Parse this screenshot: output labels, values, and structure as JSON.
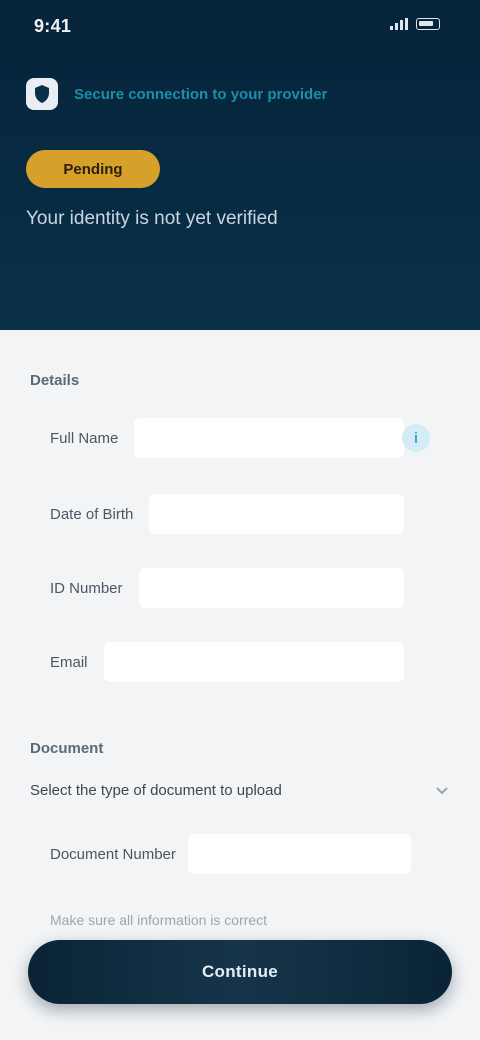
{
  "status_bar": {
    "time": "9:41"
  },
  "header": {
    "tagline": "Secure connection to your provider",
    "status_pill": "Pending",
    "message": "Your identity is not yet verified"
  },
  "personal": {
    "section_title": "Details",
    "fields": [
      {
        "label": "Full Name",
        "placeholder": ""
      },
      {
        "label": "Date of Birth",
        "placeholder": ""
      },
      {
        "label": "ID Number",
        "placeholder": ""
      },
      {
        "label": "Email",
        "placeholder": ""
      }
    ]
  },
  "document": {
    "section_title": "Document",
    "dropdown_value": "Select the type of document to upload",
    "sub_field_label": "Document Number",
    "sub_field_placeholder": "",
    "hint": "Make sure all information is correct"
  },
  "actions": {
    "primary_label": "Continue"
  },
  "colors": {
    "header_bg": "#06243a",
    "pill": "#d6a12a",
    "accent": "#1a8fa8",
    "info": "#3aa7cf",
    "button": "#0a2436"
  },
  "icons": {
    "logo": "shield-icon",
    "info": "info-icon",
    "dropdown": "chevron-down-icon"
  }
}
